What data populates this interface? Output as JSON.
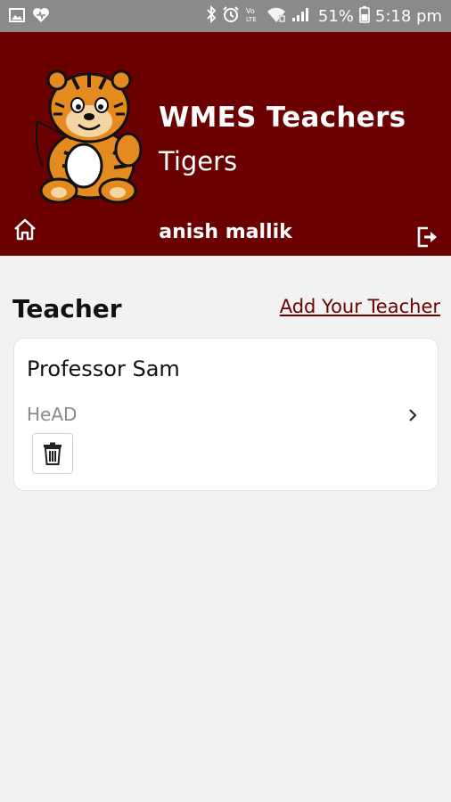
{
  "status_bar": {
    "battery": "51%",
    "time": "5:18 pm",
    "icons": [
      "image-icon",
      "heart-icon",
      "bluetooth-icon",
      "alarm-icon",
      "volte-icon",
      "wifi-icon",
      "signal-icon",
      "battery-icon"
    ]
  },
  "header": {
    "title": "WMES Teachers",
    "subtitle": "Tigers",
    "user_name": "anish mallik",
    "background": "#6b0000"
  },
  "main": {
    "section_title": "Teacher",
    "add_link": "Add Your Teacher",
    "teachers": [
      {
        "name": "Professor Sam",
        "role": "HeAD"
      }
    ]
  }
}
